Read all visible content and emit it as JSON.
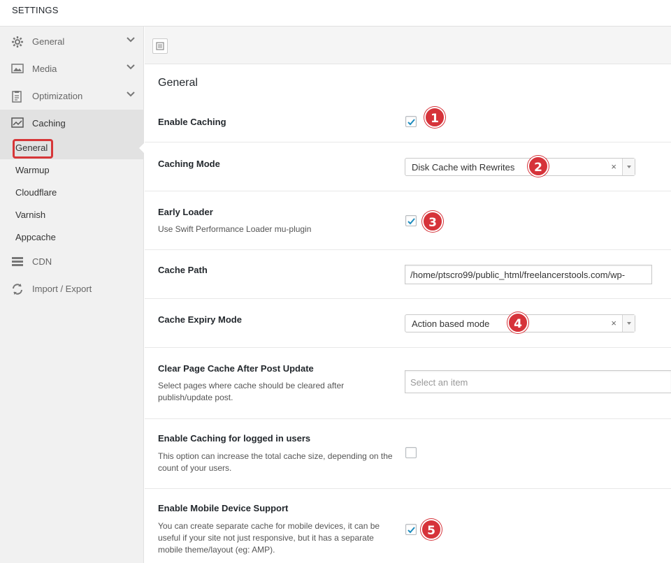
{
  "header": {
    "title": "SETTINGS"
  },
  "sidebar": {
    "items": [
      {
        "label": "General",
        "icon": "gear-icon"
      },
      {
        "label": "Media",
        "icon": "image-icon"
      },
      {
        "label": "Optimization",
        "icon": "clipboard-icon"
      },
      {
        "label": "Caching",
        "icon": "chart-icon"
      },
      {
        "label": "CDN",
        "icon": "server-icon"
      },
      {
        "label": "Import / Export",
        "icon": "refresh-icon"
      }
    ],
    "subitems": [
      "General",
      "Warmup",
      "Cloudflare",
      "Varnish",
      "Appcache"
    ]
  },
  "main": {
    "section_title": "General",
    "rows": [
      {
        "label": "Enable Caching",
        "checked": true,
        "badge": "1"
      },
      {
        "label": "Caching Mode",
        "select_value": "Disk Cache with Rewrites",
        "badge": "2"
      },
      {
        "label": "Early Loader",
        "desc": "Use Swift Performance Loader mu-plugin",
        "checked": true,
        "badge": "3"
      },
      {
        "label": "Cache Path",
        "input_value": "/home/ptscro99/public_html/freelancerstools.com/wp-"
      },
      {
        "label": "Cache Expiry Mode",
        "select_value": "Action based mode",
        "badge": "4"
      },
      {
        "label": "Clear Page Cache After Post Update",
        "desc": "Select pages where cache should be cleared after publish/update post.",
        "placeholder": "Select an item"
      },
      {
        "label": "Enable Caching for logged in users",
        "desc": "This option can increase the total cache size, depending on the count of your users.",
        "checked": false
      },
      {
        "label": "Enable Mobile Device Support",
        "desc": "You can create separate cache for mobile devices, it can be useful if your site not just responsive, but it has a separate mobile theme/layout (eg: AMP).",
        "checked": true,
        "badge": "5"
      }
    ],
    "select_clear": "×"
  },
  "colors": {
    "accent_red": "#d6333a",
    "sidebar_bg": "#f1f1f1",
    "active_bg": "#e2e2e2"
  }
}
